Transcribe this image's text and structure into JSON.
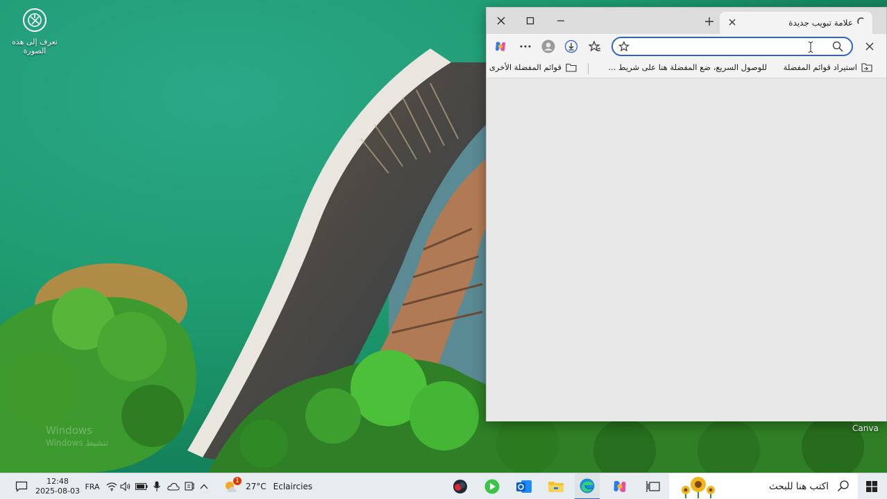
{
  "desktop": {
    "icon_label": "تعرف إلى هذه الصورة",
    "icon": "camera-aperture-icon",
    "watermark_line1": "Windows",
    "watermark_line2": "Windows تنشيط",
    "canva_label": "Canva"
  },
  "browser": {
    "tab": {
      "title": "علامة تبويب جديدة",
      "close_icon": "close-icon",
      "favicon": "loading-icon"
    },
    "window_controls": {
      "close": "close-icon",
      "maximize": "maximize-icon",
      "minimize": "minimize-icon"
    },
    "new_tab": "plus-icon",
    "toolbar": {
      "copilot": "copilot-icon",
      "more": "more-icon",
      "profile": "profile-icon",
      "downloads": "download-icon",
      "favorites": "favorites-icon",
      "close_sidebar": "close-icon"
    },
    "address": {
      "value": "",
      "placeholder": ""
    },
    "favorites_bar": {
      "import": "استيراد قوائم المفضلة",
      "hint": "للوصول السريع، ضع المفضلة هنا على شريط ...",
      "other": "قوائم المفضلة الأخرى"
    }
  },
  "taskbar": {
    "time": "12:48",
    "date": "2025-08-03",
    "language": "FRA",
    "weather_temp": "27°C",
    "weather_desc": "Eclaircies",
    "search_placeholder": "اكتب هنا للبحث",
    "weather_badge": "1"
  },
  "colors": {
    "accent": "#2b63c8",
    "taskbar_bg": "#e6ecef",
    "water": "#1d8f6a"
  }
}
